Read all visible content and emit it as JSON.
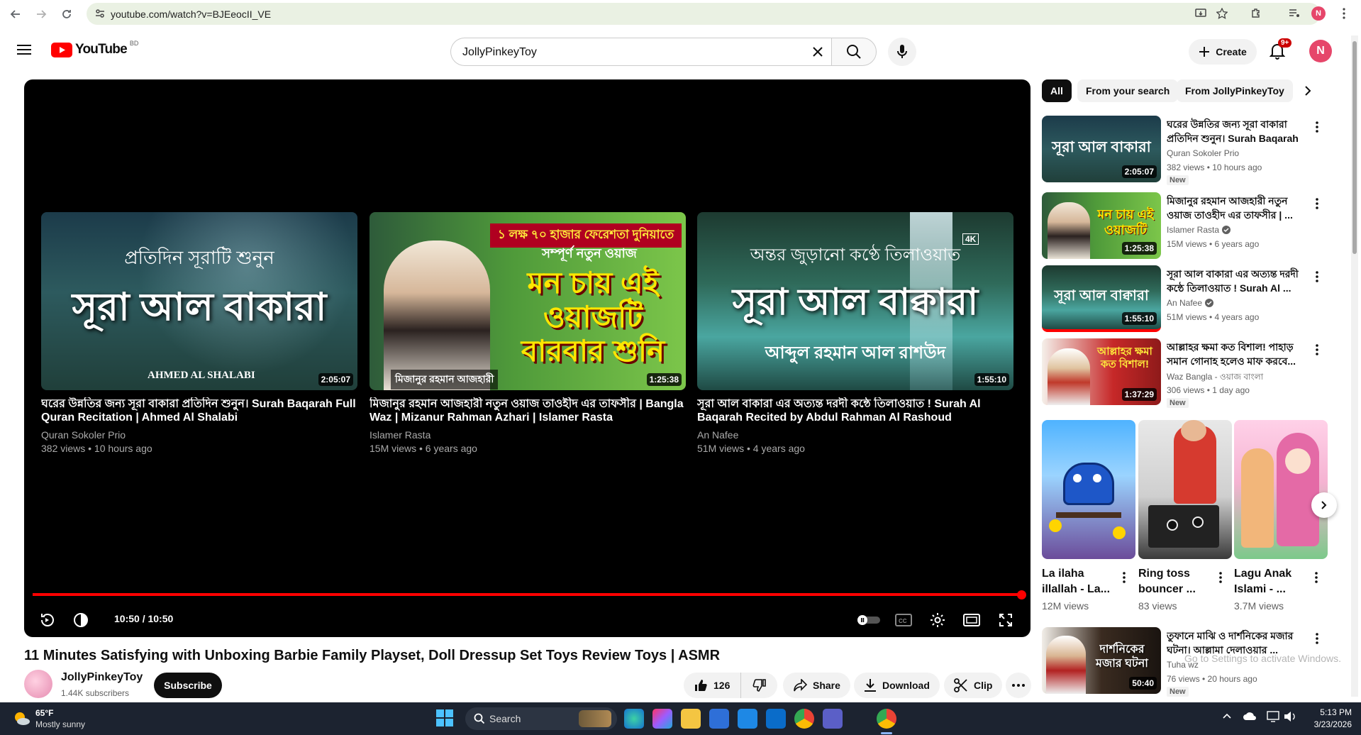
{
  "browser": {
    "url": "youtube.com/watch?v=BJEeocII_VE",
    "profile_initial": "N"
  },
  "header": {
    "logo_text": "YouTube",
    "region": "BD",
    "search_value": "JollyPinkeyToy",
    "create_label": "Create",
    "notification_count": "9+",
    "avatar_initial": "N"
  },
  "player": {
    "time": "10:50 / 10:50",
    "progress": 1.0,
    "end_cards": [
      {
        "thumb_top": "প্রতিদিন সূরাটি শুনুন",
        "thumb_main": "সূরা আল বাকারা",
        "thumb_bottom": "AHMED  AL  SHALABI",
        "duration": "2:05:07",
        "title": "ঘরের উন্নতির জন্য সূরা বাকারা প্রতিদিন শুনুন। Surah Baqarah Full Quran Recitation | Ahmed Al Shalabi",
        "channel": "Quran Sokoler Prio",
        "meta": "382 views • 10 hours ago"
      },
      {
        "thumb_top": "১ লক্ষ ৭০ হাজার ফেরেশতা দুনিয়াতে",
        "thumb_sub": "সম্পূর্ণ নতুন ওয়াজ",
        "thumb_main": "মন চায় এই ওয়াজটি বারবার শুনি",
        "thumb_bottom": "মিজানুর রহমান আজহারী",
        "duration": "1:25:38",
        "title": "মিজানুর রহমান আজহারী নতুন ওয়াজ তাওহীদ এর তাফসীর | Bangla Waz | Mizanur Rahman Azhari | Islamer Rasta",
        "channel": "Islamer Rasta",
        "meta": "15M views • 6 years ago"
      },
      {
        "thumb_top": "অন্তর জুড়ানো কণ্ঠে তিলাওয়াত",
        "thumb_main": "সূরা আল বাক্বারা",
        "thumb_bottom": "আব্দুল রহমান আল রাশউদ",
        "badge": "4K",
        "duration": "1:55:10",
        "title": "সূরা আল বাকারা এর অত্যন্ত দরদী কন্ঠে তিলাওয়াত ! Surah Al Baqarah Recited by Abdul Rahman Al Rashoud",
        "channel": "An Nafee",
        "meta": "51M views • 4 years ago"
      }
    ]
  },
  "video": {
    "title": "11 Minutes Satisfying with Unboxing Barbie Family Playset, Doll Dressup Set Toys Review Toys | ASMR",
    "channel": "JollyPinkeyToy",
    "subscribers": "1.44K subscribers",
    "subscribe_label": "Subscribe",
    "likes": "126",
    "share_label": "Share",
    "download_label": "Download",
    "clip_label": "Clip"
  },
  "sidebar": {
    "chips": [
      "All",
      "From your search",
      "From JollyPinkeyToy"
    ],
    "items": [
      {
        "title": "ঘরের উন্নতির জন্য সূরা বাকারা প্রতিদিন শুনুন। Surah Baqarah ...",
        "channel": "Quran Sokoler Prio",
        "views": "382 views • 10 hours ago",
        "badge": "New",
        "duration": "2:05:07",
        "thumb_text": "সূরা আল বাকারা"
      },
      {
        "title": "মিজানুর রহমান আজহারী নতুন ওয়াজ তাওহীদ এর তাফসীর | ...",
        "channel": "Islamer Rasta",
        "views": "15M views • 6 years ago",
        "duration": "1:25:38",
        "thumb_text": "মন চায় এই ওয়াজটি"
      },
      {
        "title": "সূরা আল বাকারা এর অত্যন্ত দরদী কন্ঠে তিলাওয়াত ! Surah Al ...",
        "channel": "An Nafee",
        "views": "51M views • 4 years ago",
        "duration": "1:55:10",
        "thumb_text": "সূরা আল বাক্বারা"
      },
      {
        "title": "আল্লাহর ক্ষমা কত বিশাল! পাহাড় সমান গোনাহ হলেও মাফ করবে...",
        "channel": "Waz Bangla - ওয়াজ বাংলা",
        "views": "306 views • 1 day ago",
        "badge": "New",
        "duration": "1:37:29",
        "thumb_text": "আল্লাহর ক্ষমা কত বিশাল!"
      }
    ],
    "shorts": [
      {
        "title": "La ilaha illallah - La...",
        "views": "12M views"
      },
      {
        "title": "Ring toss bouncer ...",
        "views": "83 views"
      },
      {
        "title": "Lagu Anak Islami - ...",
        "views": "3.7M views"
      }
    ],
    "bottom_item": {
      "title": "তুফানে মাঝি ও দার্শনিকের মজার ঘটনা। আল্লামা দেলাওয়ার ...",
      "channel": "Tuha wz",
      "views": "76 views • 20 hours ago",
      "badge": "New",
      "duration": "50:40",
      "thumb_text": "দার্শনিকের মজার ঘটনা"
    }
  },
  "watermark": "Go to Settings to activate Windows.",
  "taskbar": {
    "weather_temp": "65°F",
    "weather_text": "Mostly sunny",
    "search_label": "Search",
    "time": "5:13 PM",
    "date": "3/23/2026"
  }
}
